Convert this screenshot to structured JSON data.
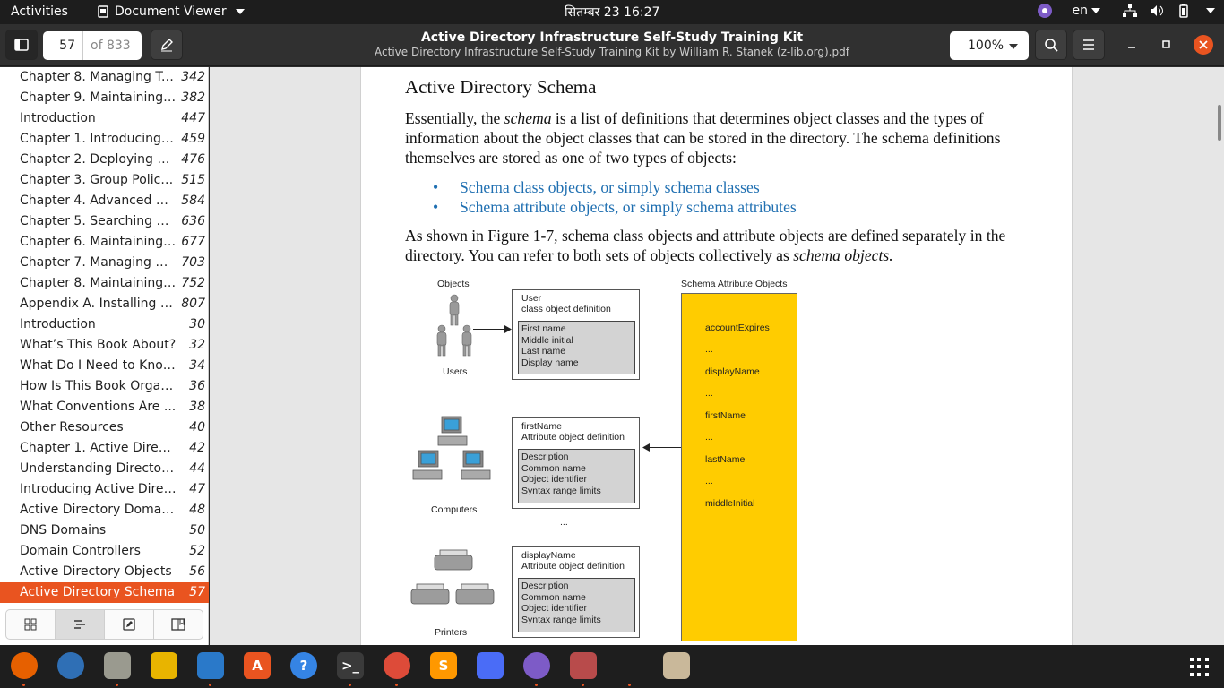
{
  "topbar": {
    "activities": "Activities",
    "app_name": "Document Viewer",
    "clock": "सितम्बर 23  16:27",
    "language": "en"
  },
  "header": {
    "page_current": "57",
    "page_total": "of 833",
    "title": "Active Directory Infrastructure Self-Study Training Kit",
    "subtitle": "Active Directory Infrastructure Self-Study Training Kit by William R. Stanek (z-lib.org).pdf",
    "zoom": "100%"
  },
  "toc": [
    {
      "label": "Chapter 8. Managing Tr...",
      "page": "342"
    },
    {
      "label": "Chapter 9. Maintaining ...",
      "page": "382"
    },
    {
      "label": "Introduction",
      "page": "447"
    },
    {
      "label": "Chapter 1. Introducing ...",
      "page": "459"
    },
    {
      "label": "Chapter 2. Deploying Gr...",
      "page": "476"
    },
    {
      "label": "Chapter 3. Group Policy ...",
      "page": "515"
    },
    {
      "label": "Chapter 4. Advanced Gr...",
      "page": "584"
    },
    {
      "label": "Chapter 5. Searching an...",
      "page": "636"
    },
    {
      "label": "Chapter 6. Maintaining t...",
      "page": "677"
    },
    {
      "label": "Chapter 7. Managing Gr...",
      "page": "703"
    },
    {
      "label": "Chapter 8. Maintaining ...",
      "page": "752"
    },
    {
      "label": "Appendix A. Installing G...",
      "page": "807"
    },
    {
      "label": "Introduction",
      "page": "30"
    },
    {
      "label": "What’s This Book About?",
      "page": "32"
    },
    {
      "label": "What Do I Need to Know?",
      "page": "34"
    },
    {
      "label": "How Is This Book Organi...",
      "page": "36"
    },
    {
      "label": "What Conventions Are ...",
      "page": "38"
    },
    {
      "label": "Other Resources",
      "page": "40"
    },
    {
      "label": "Chapter 1. Active Direct...",
      "page": "42"
    },
    {
      "label": "Understanding Director...",
      "page": "44"
    },
    {
      "label": "Introducing Active Direc...",
      "page": "47"
    },
    {
      "label": "Active Directory Domains",
      "page": "48"
    },
    {
      "label": "DNS Domains",
      "page": "50"
    },
    {
      "label": "Domain Controllers",
      "page": "52"
    },
    {
      "label": "Active Directory Objects",
      "page": "56"
    },
    {
      "label": "Active Directory Schema",
      "page": "57",
      "selected": true
    }
  ],
  "doc": {
    "heading": "Active Directory Schema",
    "para1_a": "Essentially, the ",
    "para1_em": "schema",
    "para1_b": " is a list of definitions that determines object classes and the types of information about the object classes that can be stored in the directory. The schema definitions themselves are stored as one of two types of objects:",
    "bullets": [
      "Schema class objects, or simply schema classes",
      "Schema attribute objects, or simply schema attributes"
    ],
    "para2_a": "As shown in Figure 1-7, schema class objects and attribute objects are defined separately in the directory. You can refer to both sets of objects collectively as ",
    "para2_em": "schema objects.",
    "figure": {
      "objects_header": "Objects",
      "attr_header": "Schema Attribute Objects",
      "users_label": "Users",
      "computers_label": "Computers",
      "printers_label": "Printers",
      "ellipsis": "...",
      "box1": {
        "line1": "User",
        "line2": "class object definition",
        "fields": [
          "First name",
          "Middle initial",
          "Last name",
          "Display name"
        ]
      },
      "box2": {
        "line1": "firstName",
        "line2": "Attribute object definition",
        "fields": [
          "Description",
          "Common name",
          "Object identifier",
          "Syntax range limits"
        ]
      },
      "box3": {
        "line1": "displayName",
        "line2": "Attribute object definition",
        "fields": [
          "Description",
          "Common name",
          "Object identifier",
          "Syntax range limits"
        ]
      },
      "attributes": [
        "accountExpires",
        "...",
        "displayName",
        "...",
        "firstName",
        "...",
        "lastName",
        "...",
        "middleInitial"
      ]
    }
  },
  "dock": [
    {
      "icon": "firefox-icon",
      "color": "#e66000",
      "glyph": "",
      "running": true
    },
    {
      "icon": "thunderbird-icon",
      "color": "#2f6fb5",
      "glyph": "",
      "running": false
    },
    {
      "icon": "files-icon",
      "color": "#9a9a8f",
      "glyph": "",
      "running": true
    },
    {
      "icon": "rhythmbox-icon",
      "color": "#e8b400",
      "glyph": "",
      "running": false
    },
    {
      "icon": "writer-icon",
      "color": "#2a79c9",
      "glyph": "",
      "running": true
    },
    {
      "icon": "software-icon",
      "color": "#e95420",
      "glyph": "A",
      "running": false
    },
    {
      "icon": "help-icon",
      "color": "#3584e4",
      "glyph": "?",
      "running": false
    },
    {
      "icon": "terminal-icon",
      "color": "#3a3a3a",
      "glyph": ">_",
      "running": true
    },
    {
      "icon": "chrome-icon",
      "color": "#dd4b39",
      "glyph": "",
      "running": true
    },
    {
      "icon": "sublime-icon",
      "color": "#ff9800",
      "glyph": "S",
      "running": false
    },
    {
      "icon": "screenshot-icon",
      "color": "#4a6cf7",
      "glyph": "",
      "running": false
    },
    {
      "icon": "viber-icon",
      "color": "#7d5bc7",
      "glyph": "",
      "running": true
    },
    {
      "icon": "document-viewer-icon",
      "color": "#b84b4b",
      "glyph": "",
      "running": true
    },
    {
      "icon": "trash-icon",
      "color": "#1e1e1e",
      "glyph": "",
      "running": true
    },
    {
      "icon": "archive-icon",
      "color": "#c9b89a",
      "glyph": "",
      "running": false
    }
  ]
}
